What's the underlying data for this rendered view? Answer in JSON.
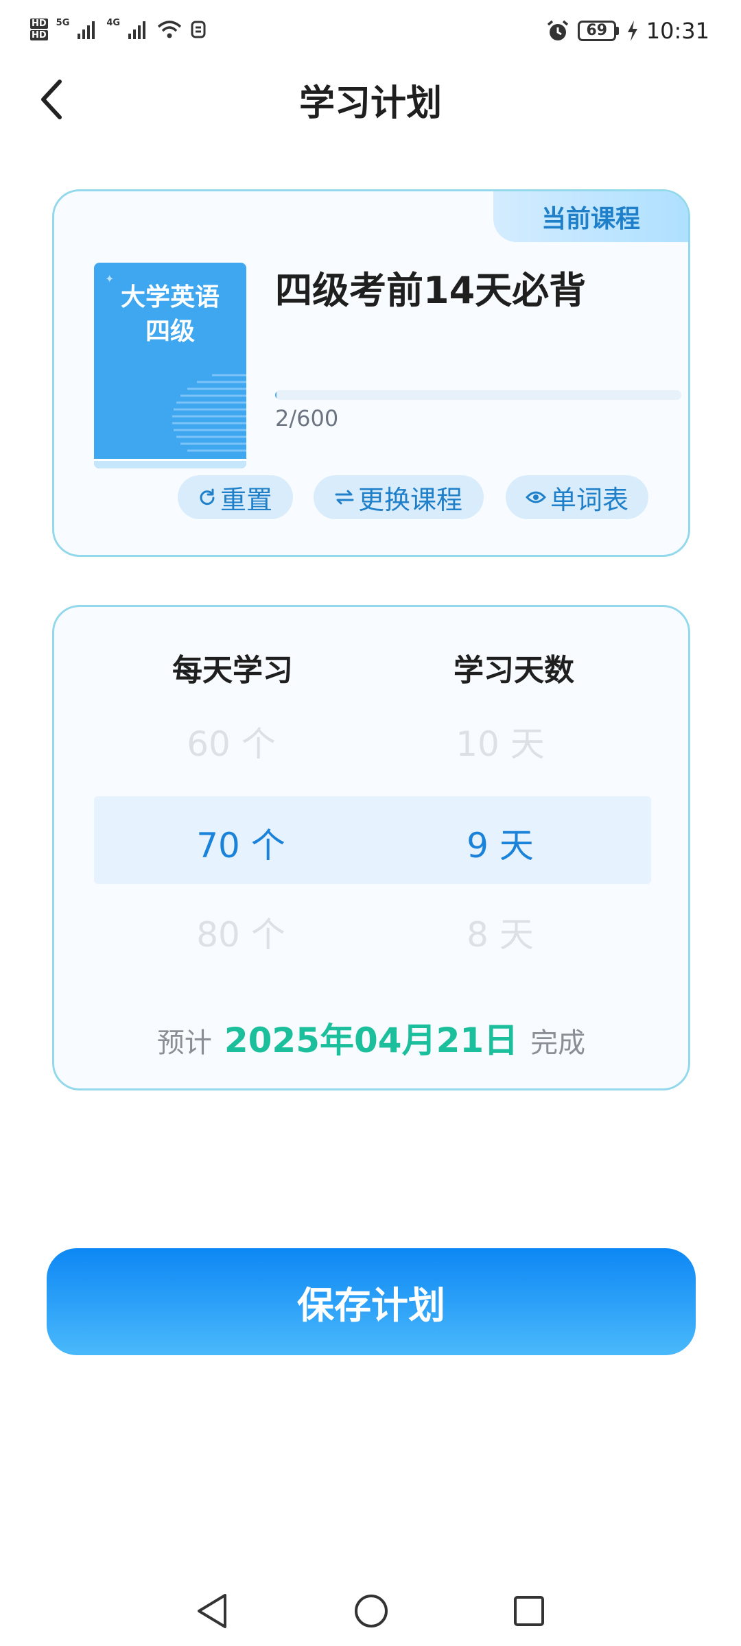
{
  "status_bar": {
    "hd1": "HD",
    "hd2": "HD",
    "net1": "5G",
    "net2": "4G",
    "battery": "69",
    "time": "10:31"
  },
  "header": {
    "title": "学习计划"
  },
  "course": {
    "badge": "当前课程",
    "cover_title_line1": "大学英语",
    "cover_title_line2": "四级",
    "name": "四级考前14天必背",
    "progress_text": "2/600",
    "progress_fraction": 0.0033,
    "actions": [
      {
        "label": "重置",
        "icon": "refresh-icon"
      },
      {
        "label": "更换课程",
        "icon": "swap-icon"
      },
      {
        "label": "单词表",
        "icon": "eye-icon"
      }
    ]
  },
  "plan": {
    "col_daily": "每天学习",
    "col_days": "学习天数",
    "daily_options": [
      "60 个",
      "70 个",
      "80 个"
    ],
    "days_options": [
      "10 天",
      "9 天",
      "8 天"
    ],
    "selected_index": 1,
    "estimate_prefix": "预计",
    "estimate_date": "2025年04月21日",
    "estimate_suffix": "完成"
  },
  "save_button": "保存计划",
  "colors": {
    "accent": "#1a82d8",
    "date_green": "#1cbf9c",
    "card_border": "#94d8ec"
  }
}
